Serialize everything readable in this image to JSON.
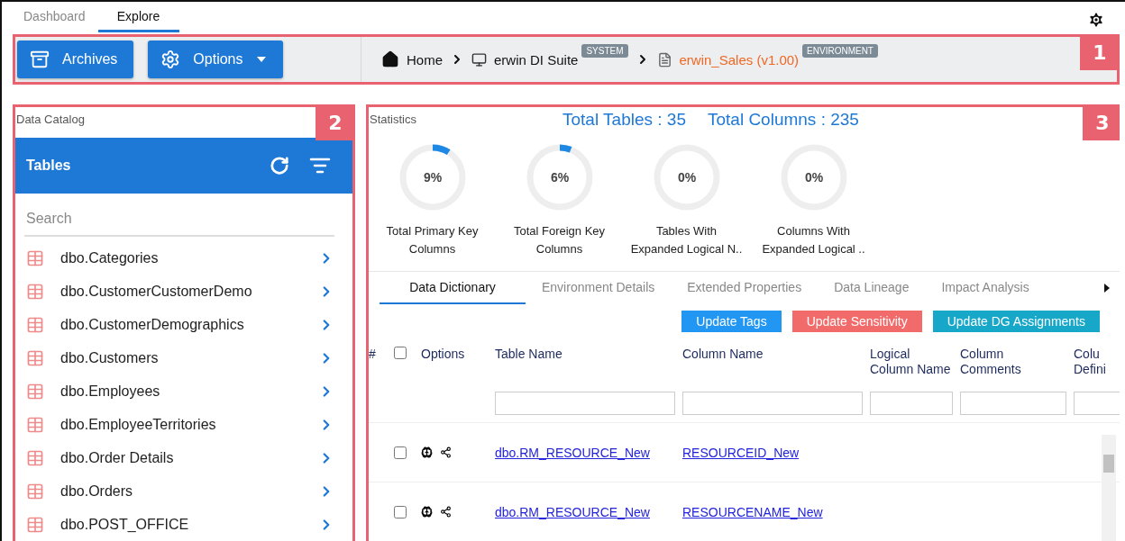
{
  "top_tabs": [
    {
      "label": "Dashboard",
      "selected": false
    },
    {
      "label": "Explore",
      "selected": true
    }
  ],
  "toolbar": {
    "callout": "1",
    "buttons": [
      {
        "label": "Archives",
        "kind": "plain"
      },
      {
        "label": "Options",
        "kind": "dropdown"
      }
    ],
    "breadcrumb": [
      {
        "kind": "home",
        "label": "Home"
      },
      {
        "kind": "system",
        "label": "erwin DI Suite",
        "badge": "SYSTEM"
      },
      {
        "kind": "document",
        "label": "erwin_Sales (v1.00)",
        "badge": "ENVIRONMENT"
      }
    ]
  },
  "catalog": {
    "callout": "2",
    "title": "Data Catalog",
    "header": "Tables",
    "search": {
      "placeholder": "Search"
    },
    "items": [
      "dbo.Categories",
      "dbo.CustomerCustomerDemo",
      "dbo.CustomerDemographics",
      "dbo.Customers",
      "dbo.Employees",
      "dbo.EmployeeTerritories",
      "dbo.Order Details",
      "dbo.Orders",
      "dbo.POST_OFFICE"
    ]
  },
  "details": {
    "callout": "3",
    "title": "Statistics",
    "totals": [
      "Total Tables : 35",
      "Total Columns : 235"
    ],
    "gauges": [
      {
        "value": "9%",
        "label_lines": [
          "Total Primary Key",
          "Columns"
        ]
      },
      {
        "value": "6%",
        "label_lines": [
          "Total Foreign Key",
          "Columns"
        ]
      },
      {
        "value": "0%",
        "label_lines": [
          "Tables With",
          "Expanded Logical N.."
        ]
      },
      {
        "value": "0%",
        "label_lines": [
          "Columns With",
          "Expanded Logical .."
        ]
      }
    ],
    "tabs": [
      {
        "label": "Data Dictionary",
        "selected": true
      },
      {
        "label": "Environment Details",
        "selected": false
      },
      {
        "label": "Extended Properties",
        "selected": false
      },
      {
        "label": "Data Lineage",
        "selected": false
      },
      {
        "label": "Impact Analysis",
        "selected": false
      }
    ],
    "actions": [
      {
        "label": "Update Tags",
        "color": "#2196f3"
      },
      {
        "label": "Update Sensitivity",
        "color": "#f26b6b"
      },
      {
        "label": "Update DG Assignments",
        "color": "#17a7c9"
      }
    ],
    "table": {
      "columns": [
        {
          "kind": "number",
          "label": "#"
        },
        {
          "kind": "checkbox",
          "checked": false
        },
        {
          "kind": "options",
          "label": "Options"
        },
        {
          "kind": "text",
          "label": "Table Name",
          "filter": true
        },
        {
          "kind": "text",
          "label": "Column Name",
          "filter": true
        },
        {
          "kind": "text",
          "label": "Logical Column Name",
          "filter": true
        },
        {
          "kind": "text",
          "label": "Column Comments",
          "filter": true
        },
        {
          "kind": "text",
          "label": "Colu Defini",
          "filter": true
        }
      ],
      "rows": [
        {
          "checked": false,
          "table_name": "dbo.RM_RESOURCE_New",
          "column_name": "RESOURCEID_New"
        },
        {
          "checked": false,
          "table_name": "dbo.RM_RESOURCE_New",
          "column_name": "RESOURCENAME_New"
        }
      ]
    }
  }
}
